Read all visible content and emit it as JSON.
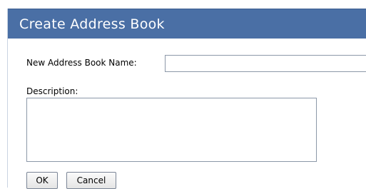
{
  "dialog": {
    "title": "Create Address Book"
  },
  "form": {
    "name_label": "New Address Book Name:",
    "name_value": "",
    "description_label": "Description:",
    "description_value": ""
  },
  "buttons": {
    "ok_label": "OK",
    "cancel_label": "Cancel"
  },
  "colors": {
    "header_background": "#4a6fa5",
    "header_text": "#ffffff"
  }
}
